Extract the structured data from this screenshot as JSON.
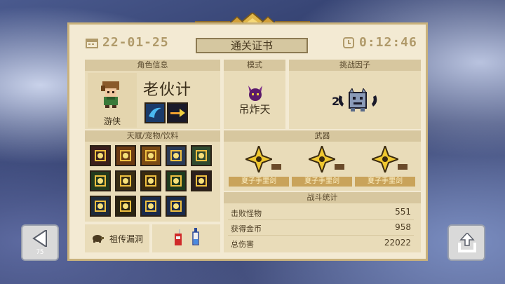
{
  "header": {
    "date": "22-01-25",
    "time": "0:12:46",
    "title": "通关证书"
  },
  "character": {
    "section_label": "角色信息",
    "name": "老伙计",
    "class": "游侠"
  },
  "mode": {
    "section_label": "模式",
    "name": "吊炸天"
  },
  "challenge": {
    "section_label": "挑战因子",
    "count": "2"
  },
  "talents": {
    "section_label": "天赋/宠物/饮料",
    "pet_name": "祖传漏洞",
    "tiles": [
      {
        "icon": "red-slash-icon",
        "bg": "#3b1f1c"
      },
      {
        "icon": "flame-shield-icon",
        "bg": "#6b3a12"
      },
      {
        "icon": "gold-badge-icon",
        "bg": "#7a4a14"
      },
      {
        "icon": "monitor-icon",
        "bg": "#2a3a55"
      },
      {
        "icon": "green-cube-icon",
        "bg": "#2f4a2f"
      },
      {
        "icon": "green-arrows-icon",
        "bg": "#233a1e"
      },
      {
        "icon": "gold-rays-icon",
        "bg": "#3a2e14"
      },
      {
        "icon": "explosion-icon",
        "bg": "#3a2a10"
      },
      {
        "icon": "green-shield-icon",
        "bg": "#1e3a1e"
      },
      {
        "icon": "potion-plus2-icon",
        "bg": "#2a1e1e"
      },
      {
        "icon": "circle-target-icon",
        "bg": "#1e2a3a"
      },
      {
        "icon": "gold-wings-icon",
        "bg": "#2a2410"
      },
      {
        "icon": "blue-blades-icon",
        "bg": "#1a2a4a"
      },
      {
        "icon": "blue-brain-icon",
        "bg": "#1a2a4a"
      }
    ]
  },
  "weapons": {
    "section_label": "武器",
    "items": [
      {
        "name": "夏子手里剑"
      },
      {
        "name": "夏子手里剑"
      },
      {
        "name": "夏子手里剑"
      }
    ]
  },
  "stats": {
    "section_label": "战斗统计",
    "rows": [
      {
        "label": "击败怪物",
        "value": "551"
      },
      {
        "label": "获得金币",
        "value": "958"
      },
      {
        "label": "总伤害",
        "value": "22022"
      }
    ]
  },
  "back_button": {
    "label": "75"
  },
  "colors": {
    "card": "#f3ead3",
    "panel": "#e9dcb9",
    "header": "#d7c79f",
    "gold": "#c9a35a"
  }
}
